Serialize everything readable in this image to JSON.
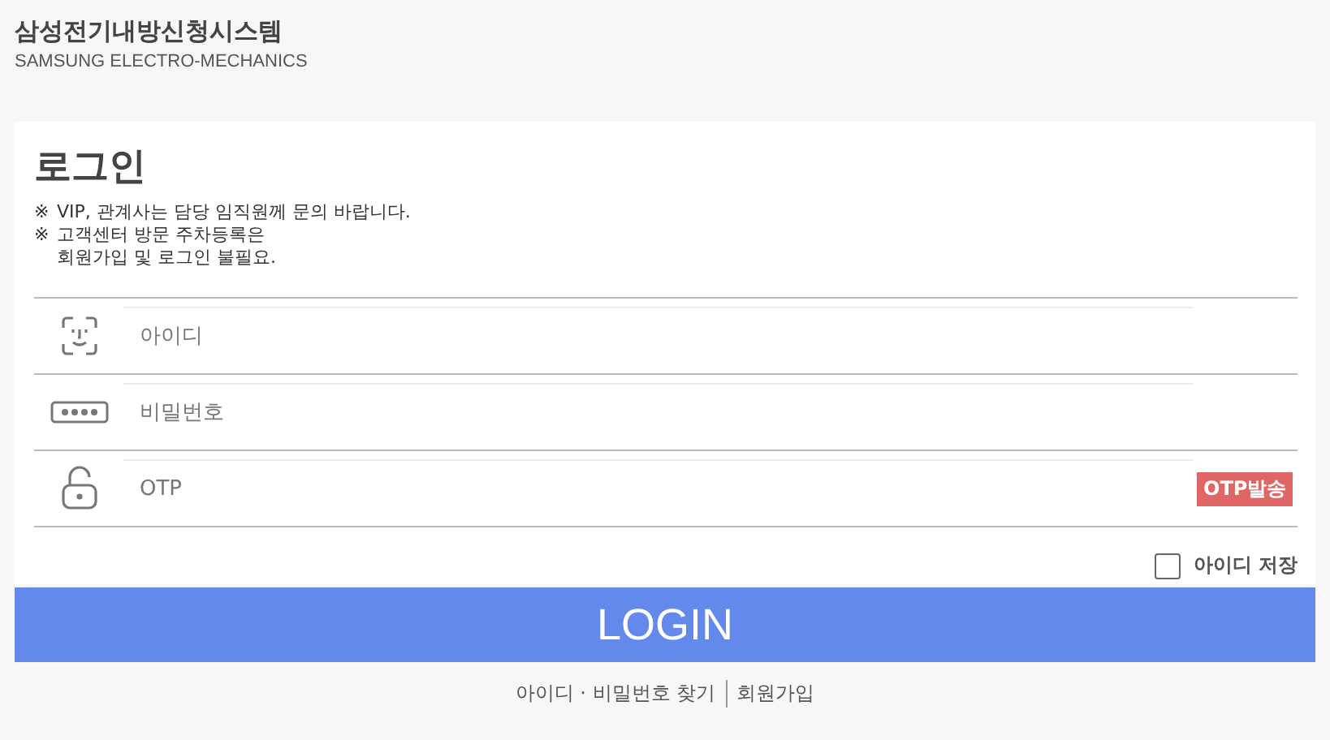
{
  "header": {
    "title": "삼성전기내방신청시스템",
    "subtitle": "SAMSUNG ELECTRO-MECHANICS"
  },
  "login": {
    "heading": "로그인",
    "notes": [
      {
        "mark": "※",
        "text": "VIP, 관계사는 담당 임직원께 문의 바랍니다."
      },
      {
        "mark": "※",
        "text": "고객센터 방문 주차등록은"
      },
      {
        "text": "회원가입 및 로그인 불필요."
      }
    ],
    "fields": [
      {
        "kind": "face",
        "placeholder": "아이디"
      },
      {
        "kind": "password",
        "placeholder": "비밀번호"
      },
      {
        "kind": "lock",
        "placeholder": "OTP",
        "action": "OTP발송"
      }
    ],
    "remember": {
      "label": "아이디 저장",
      "checked": false
    },
    "submit": "LOGIN"
  },
  "links": [
    "아이디 · 비밀번호 찾기",
    "회원가입"
  ]
}
